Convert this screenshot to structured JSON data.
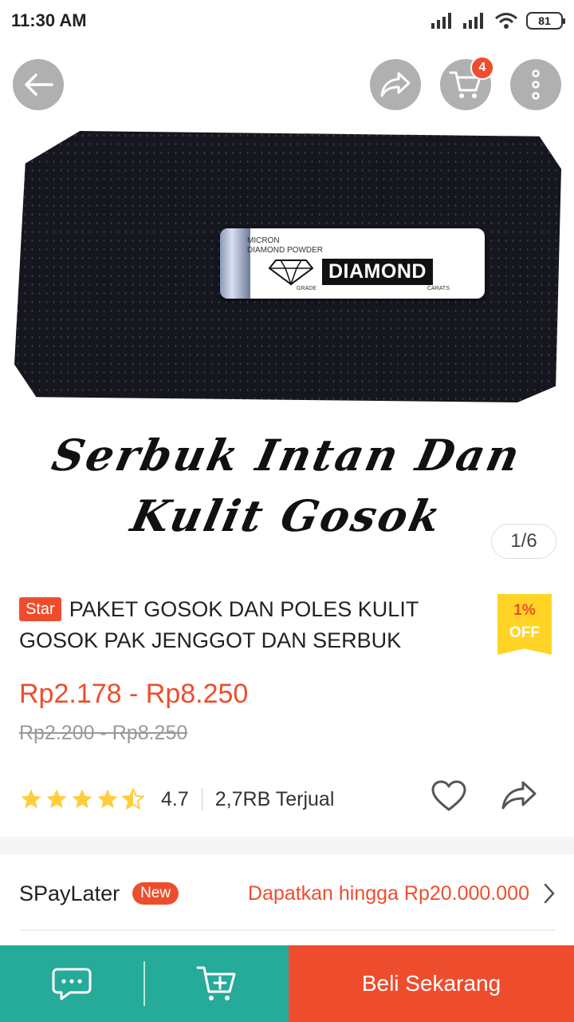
{
  "status_bar": {
    "time": "11:30 AM",
    "battery": "81"
  },
  "nav": {
    "cart_count": "4"
  },
  "image": {
    "caption_line1": "Serbuk Intan Dan",
    "caption_line2": "Kulit Gosok",
    "counter": "1/6",
    "tube_small_line1": "MICRON",
    "tube_small_line2": "DIAMOND POWDER",
    "tube_label": "DIAMOND",
    "tube_grade": "GRADE",
    "tube_carats": "CARATS"
  },
  "product": {
    "badge": "Star",
    "title": "PAKET GOSOK DAN POLES KULIT GOSOK PAK JENGGOT DAN SERBUK",
    "discount_percent": "1%",
    "discount_off": "OFF",
    "price": "Rp2.178 - Rp8.250",
    "original_price": "Rp2.200 - Rp8.250",
    "rating": "4.7",
    "rating_value": 4.7,
    "sold": "2,7RB Terjual"
  },
  "spaylater": {
    "name": "SPayLater",
    "badge": "New",
    "offer": "Dapatkan hingga Rp20.000.000"
  },
  "bottom_bar": {
    "buy_label": "Beli Sekarang"
  },
  "colors": {
    "accent": "#ee4d2d",
    "teal": "#26aa99",
    "star": "#ffce3d"
  }
}
